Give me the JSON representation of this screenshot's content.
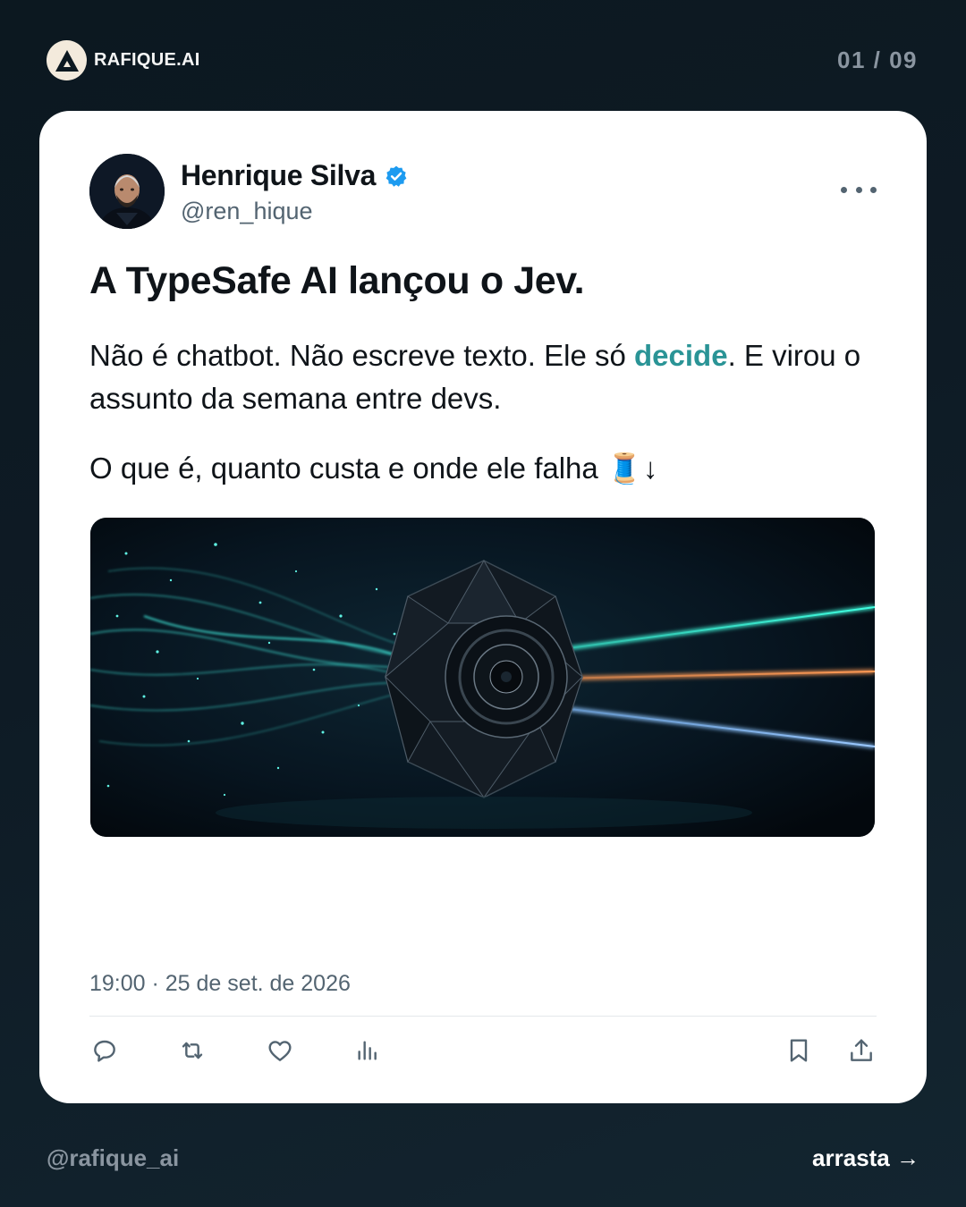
{
  "brand": {
    "name": "RAFIQUE.AI",
    "logo_icon": "triangle-logo-icon"
  },
  "pager": "01 / 09",
  "tweet": {
    "author_name": "Henrique Silva",
    "handle": "@ren_hique",
    "verified": true,
    "headline": "A TypeSafe AI lançou o Jev.",
    "body_part1": "Não é chatbot. Não escreve texto. Ele só ",
    "body_highlight": "decide",
    "body_part2": ". E virou o assunto da semana entre devs.",
    "body_line2": "O que é, quanto custa e onde ele falha 🧵↓",
    "timestamp": "19:00 · 25 de set. de 2026",
    "accent_color": "#2a9496",
    "media_icon": "polyhedron-light-beams-image"
  },
  "actions": [
    "reply-icon",
    "retweet-icon",
    "like-icon",
    "views-icon",
    "bookmark-icon",
    "share-icon"
  ],
  "footer": {
    "handle": "@rafique_ai",
    "next_label": "arrasta →"
  }
}
